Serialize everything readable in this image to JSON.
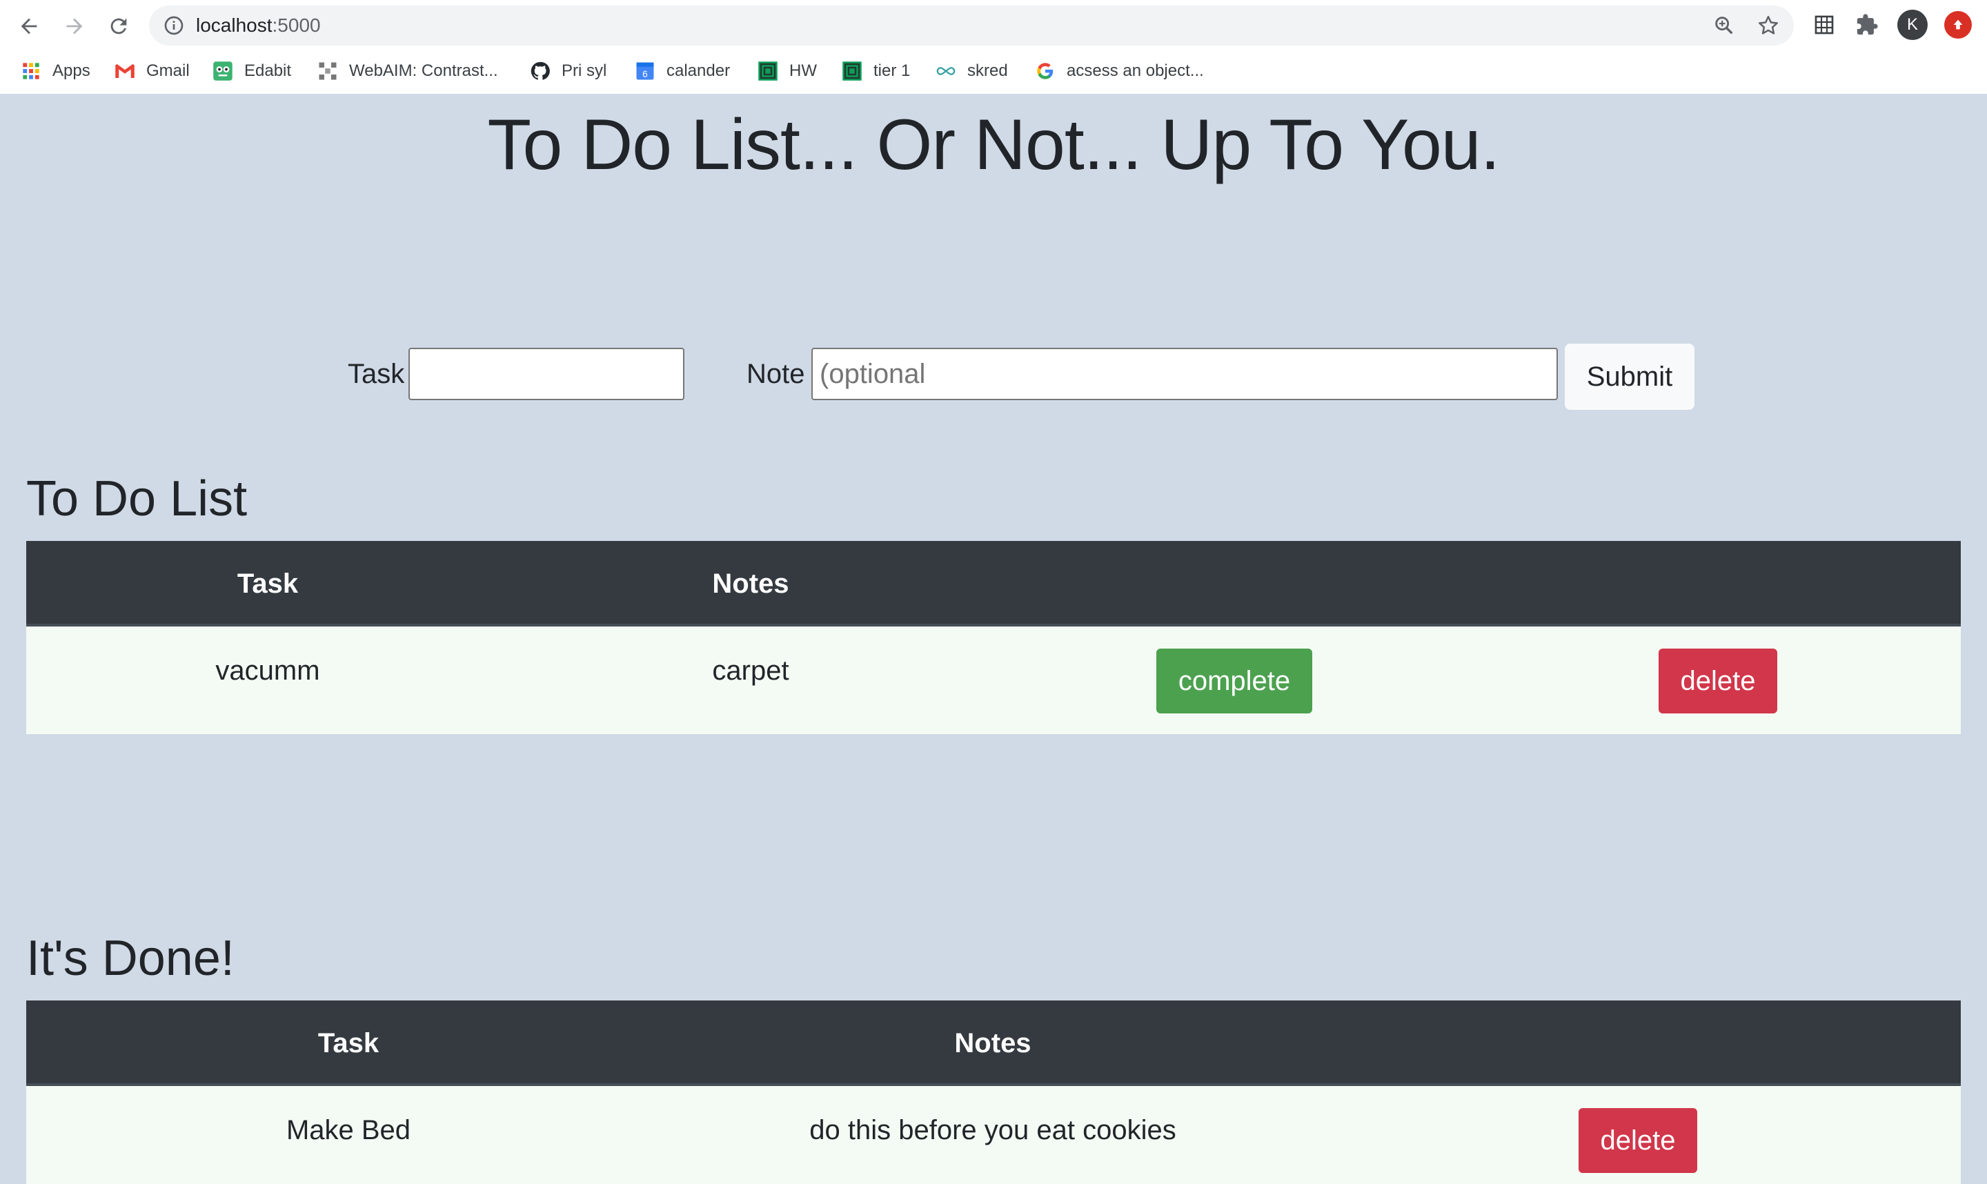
{
  "browser": {
    "url_host": "localhost",
    "url_port": ":5000",
    "avatar_letter": "K",
    "bookmarks": [
      {
        "label": "Apps",
        "icon": "apps-grid-icon"
      },
      {
        "label": "Gmail",
        "icon": "gmail-icon"
      },
      {
        "label": "Edabit",
        "icon": "edabit-icon"
      },
      {
        "label": "WebAIM: Contrast...",
        "icon": "webaim-icon"
      },
      {
        "label": "Pri syl",
        "icon": "github-icon"
      },
      {
        "label": "calander",
        "icon": "calendar-icon"
      },
      {
        "label": "HW",
        "icon": "classroom-icon"
      },
      {
        "label": "tier 1",
        "icon": "classroom-icon"
      },
      {
        "label": "skred",
        "icon": "infinity-icon"
      },
      {
        "label": "acsess an object...",
        "icon": "google-icon"
      }
    ]
  },
  "page": {
    "title": "To Do List... Or Not... Up To You."
  },
  "form": {
    "task_label": "Task",
    "task_value": "",
    "note_label": "Note",
    "note_placeholder": "(optional",
    "note_value": "",
    "submit_label": "Submit"
  },
  "todo": {
    "heading": "To Do List",
    "columns": [
      "Task",
      "Notes"
    ],
    "rows": [
      {
        "task": "vacumm",
        "notes": "carpet",
        "complete_label": "complete",
        "delete_label": "delete"
      }
    ]
  },
  "done": {
    "heading": "It's Done!",
    "columns": [
      "Task",
      "Notes"
    ],
    "rows": [
      {
        "task": "Make Bed",
        "notes": "do this before you eat cookies",
        "delete_label": "delete"
      }
    ]
  },
  "colors": {
    "page_bg": "#d0dae6",
    "table_header": "#343a40",
    "row_bg": "#f4fbf4",
    "complete_button": "#4ca14f",
    "delete_button": "#d1364a"
  }
}
